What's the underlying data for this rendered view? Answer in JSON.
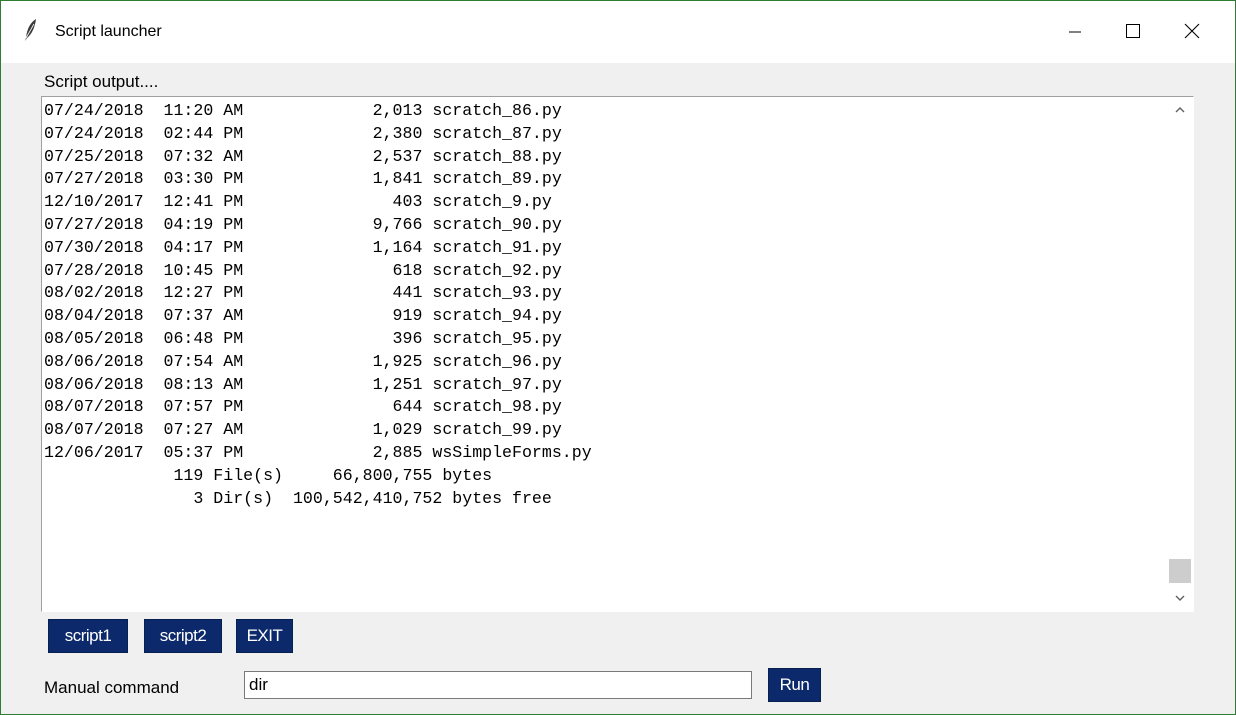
{
  "window": {
    "title": "Script launcher",
    "icon": "feather-icon",
    "controls": {
      "minimize": "minimize-icon",
      "maximize": "maximize-icon",
      "close": "close-icon"
    }
  },
  "output": {
    "label": "Script output....",
    "lines": [
      "07/24/2018  11:20 AM             2,013 scratch_86.py",
      "07/24/2018  02:44 PM             2,380 scratch_87.py",
      "07/25/2018  07:32 AM             2,537 scratch_88.py",
      "07/27/2018  03:30 PM             1,841 scratch_89.py",
      "12/10/2017  12:41 PM               403 scratch_9.py",
      "07/27/2018  04:19 PM             9,766 scratch_90.py",
      "07/30/2018  04:17 PM             1,164 scratch_91.py",
      "07/28/2018  10:45 PM               618 scratch_92.py",
      "08/02/2018  12:27 PM               441 scratch_93.py",
      "08/04/2018  07:37 AM               919 scratch_94.py",
      "08/05/2018  06:48 PM               396 scratch_95.py",
      "08/06/2018  07:54 AM             1,925 scratch_96.py",
      "08/06/2018  08:13 AM             1,251 scratch_97.py",
      "08/07/2018  07:57 PM               644 scratch_98.py",
      "08/07/2018  07:27 AM             1,029 scratch_99.py",
      "12/06/2017  05:37 PM             2,885 wsSimpleForms.py",
      "             119 File(s)     66,800,755 bytes",
      "               3 Dir(s)  100,542,410,752 bytes free"
    ],
    "text": ""
  },
  "buttons": {
    "script1": "script1",
    "script2": "script2",
    "exit": "EXIT",
    "run": "Run"
  },
  "command": {
    "label": "Manual command",
    "value": "dir"
  },
  "colors": {
    "button_bg": "#0c2a6b",
    "button_text": "#ffffff",
    "window_bg": "#f0f0f0",
    "window_border": "#2e7d32"
  }
}
